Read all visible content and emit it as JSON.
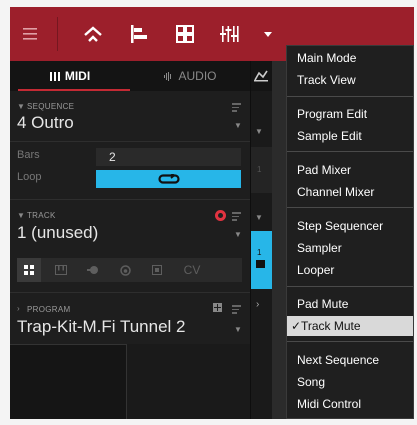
{
  "topbar": {
    "icons": [
      "hamburger-icon",
      "home-mode-icon",
      "track-view-icon",
      "grid-view-icon",
      "mixer-icon",
      "chevron-down-icon"
    ],
    "accent": "#9c1f2b"
  },
  "tabs": {
    "midi": "MIDI",
    "audio": "AUDIO",
    "accent": "#c42a34"
  },
  "sequence": {
    "label": "SEQUENCE",
    "value": "4 Outro",
    "bars_label": "Bars",
    "bars_value": "2",
    "loop_label": "Loop",
    "loop_color": "#27b6e8"
  },
  "track": {
    "label": "TRACK",
    "value": "1 (unused)",
    "type_icons": [
      "drum-grid-icon",
      "keygroup-icon",
      "clip-icon",
      "plugin-icon",
      "midi-icon"
    ],
    "cv_label": "CV"
  },
  "program": {
    "label": "PROGRAM",
    "value": "Trap-Kit-M.Fi Tunnel 2"
  },
  "strip": {
    "seq_row": "1",
    "track_row": "1"
  },
  "menu": {
    "items": [
      {
        "label": "Main Mode"
      },
      {
        "label": "Track View"
      },
      {
        "label": "Program Edit"
      },
      {
        "label": "Sample Edit"
      },
      {
        "label": "Pad Mixer"
      },
      {
        "label": "Channel Mixer"
      },
      {
        "label": "Step Sequencer"
      },
      {
        "label": "Sampler"
      },
      {
        "label": "Looper"
      },
      {
        "label": "Pad Mute"
      },
      {
        "label": "Track Mute",
        "checkmark": "✓"
      },
      {
        "label": "Next Sequence"
      },
      {
        "label": "Song"
      },
      {
        "label": "Midi Control"
      }
    ]
  }
}
